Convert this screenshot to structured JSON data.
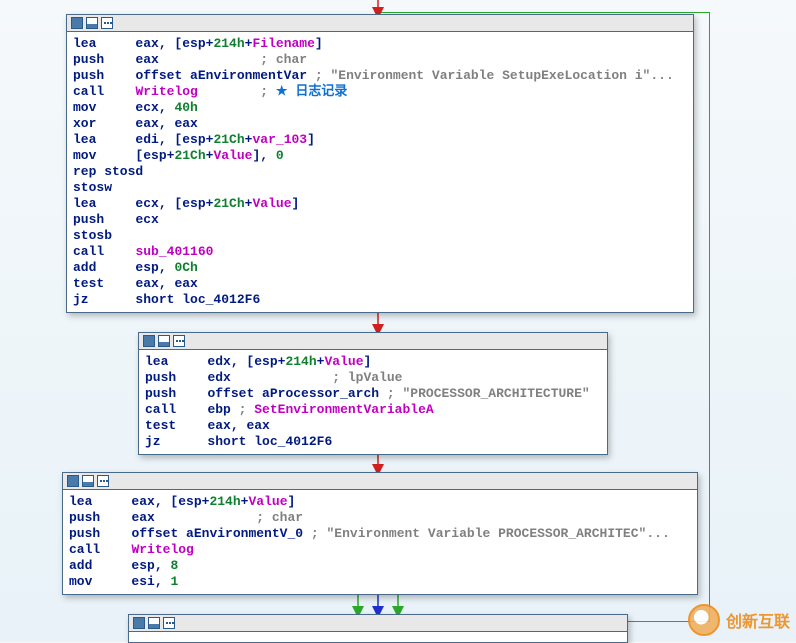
{
  "block1": {
    "lines": [
      [
        [
          "lea",
          "kw"
        ],
        [
          "     ",
          ""
        ],
        [
          "eax",
          ""
        ],
        [
          ", [",
          ""
        ],
        [
          "esp",
          "kw"
        ],
        [
          "+",
          ""
        ],
        [
          "214h",
          "num"
        ],
        [
          "+",
          ""
        ],
        [
          "Filename",
          "id"
        ],
        [
          "]",
          "pun"
        ]
      ],
      [
        [
          "push",
          "kw"
        ],
        [
          "    ",
          ""
        ],
        [
          "eax",
          ""
        ],
        [
          "             ; ",
          "str"
        ],
        [
          "char",
          "str"
        ]
      ],
      [
        [
          "push",
          "kw"
        ],
        [
          "    ",
          ""
        ],
        [
          "offset aEnvironmentVar",
          "kw"
        ],
        [
          " ; ",
          "str"
        ],
        [
          "\"Environment Variable SetupExeLocation i\"",
          "str"
        ],
        [
          "...",
          "str"
        ]
      ],
      [
        [
          "call",
          "kw"
        ],
        [
          "    ",
          ""
        ],
        [
          "Writelog",
          "id"
        ],
        [
          "        ; ",
          "str"
        ],
        [
          "★ 日志记录",
          "ann"
        ]
      ],
      [
        [
          "mov",
          "kw"
        ],
        [
          "     ",
          ""
        ],
        [
          "ecx",
          ""
        ],
        [
          ", ",
          ""
        ],
        [
          "40h",
          "num"
        ]
      ],
      [
        [
          "xor",
          "kw"
        ],
        [
          "     ",
          ""
        ],
        [
          "eax",
          ""
        ],
        [
          ", ",
          ""
        ],
        [
          "eax",
          ""
        ]
      ],
      [
        [
          "lea",
          "kw"
        ],
        [
          "     ",
          ""
        ],
        [
          "edi",
          ""
        ],
        [
          ", [",
          ""
        ],
        [
          "esp",
          "kw"
        ],
        [
          "+",
          ""
        ],
        [
          "21Ch",
          "num"
        ],
        [
          "+",
          ""
        ],
        [
          "var_103",
          "id"
        ],
        [
          "]",
          "pun"
        ]
      ],
      [
        [
          "mov",
          "kw"
        ],
        [
          "     [",
          ""
        ],
        [
          "esp",
          "kw"
        ],
        [
          "+",
          ""
        ],
        [
          "21Ch",
          "num"
        ],
        [
          "+",
          ""
        ],
        [
          "Value",
          "id"
        ],
        [
          "], ",
          ""
        ],
        [
          "0",
          "num"
        ]
      ],
      [
        [
          "rep stosd",
          "kw"
        ]
      ],
      [
        [
          "stosw",
          "kw"
        ]
      ],
      [
        [
          "lea",
          "kw"
        ],
        [
          "     ",
          ""
        ],
        [
          "ecx",
          ""
        ],
        [
          ", [",
          ""
        ],
        [
          "esp",
          "kw"
        ],
        [
          "+",
          ""
        ],
        [
          "21Ch",
          "num"
        ],
        [
          "+",
          ""
        ],
        [
          "Value",
          "id"
        ],
        [
          "]",
          "pun"
        ]
      ],
      [
        [
          "push",
          "kw"
        ],
        [
          "    ",
          ""
        ],
        [
          "ecx",
          ""
        ]
      ],
      [
        [
          "stosb",
          "kw"
        ]
      ],
      [
        [
          "call",
          "kw"
        ],
        [
          "    ",
          ""
        ],
        [
          "sub_401160",
          "id"
        ]
      ],
      [
        [
          "add",
          "kw"
        ],
        [
          "     ",
          ""
        ],
        [
          "esp",
          ""
        ],
        [
          ", ",
          ""
        ],
        [
          "0Ch",
          "num"
        ]
      ],
      [
        [
          "test",
          "kw"
        ],
        [
          "    ",
          ""
        ],
        [
          "eax",
          ""
        ],
        [
          ", ",
          ""
        ],
        [
          "eax",
          ""
        ]
      ],
      [
        [
          "jz",
          "kw"
        ],
        [
          "      ",
          ""
        ],
        [
          "short loc_4012F6",
          "kw"
        ]
      ]
    ]
  },
  "block2": {
    "lines": [
      [
        [
          "lea",
          "kw"
        ],
        [
          "     ",
          ""
        ],
        [
          "edx",
          ""
        ],
        [
          ", [",
          ""
        ],
        [
          "esp",
          "kw"
        ],
        [
          "+",
          ""
        ],
        [
          "214h",
          "num"
        ],
        [
          "+",
          ""
        ],
        [
          "Value",
          "id"
        ],
        [
          "]",
          "pun"
        ]
      ],
      [
        [
          "push",
          "kw"
        ],
        [
          "    ",
          ""
        ],
        [
          "edx",
          ""
        ],
        [
          "             ; ",
          "str"
        ],
        [
          "lpValue",
          "str"
        ]
      ],
      [
        [
          "push",
          "kw"
        ],
        [
          "    ",
          ""
        ],
        [
          "offset aProcessor_arch",
          "kw"
        ],
        [
          " ; ",
          "str"
        ],
        [
          "\"PROCESSOR_ARCHITECTURE\"",
          "str"
        ]
      ],
      [
        [
          "call",
          "kw"
        ],
        [
          "    ",
          ""
        ],
        [
          "ebp",
          ""
        ],
        [
          " ; ",
          "str"
        ],
        [
          "SetEnvironmentVariableA",
          "id"
        ]
      ],
      [
        [
          "test",
          "kw"
        ],
        [
          "    ",
          ""
        ],
        [
          "eax",
          ""
        ],
        [
          ", ",
          ""
        ],
        [
          "eax",
          ""
        ]
      ],
      [
        [
          "jz",
          "kw"
        ],
        [
          "      ",
          ""
        ],
        [
          "short loc_4012F6",
          "kw"
        ]
      ]
    ]
  },
  "block3": {
    "lines": [
      [
        [
          "lea",
          "kw"
        ],
        [
          "     ",
          ""
        ],
        [
          "eax",
          ""
        ],
        [
          ", [",
          ""
        ],
        [
          "esp",
          "kw"
        ],
        [
          "+",
          ""
        ],
        [
          "214h",
          "num"
        ],
        [
          "+",
          ""
        ],
        [
          "Value",
          "id"
        ],
        [
          "]",
          "pun"
        ]
      ],
      [
        [
          "push",
          "kw"
        ],
        [
          "    ",
          ""
        ],
        [
          "eax",
          ""
        ],
        [
          "             ; ",
          "str"
        ],
        [
          "char",
          "str"
        ]
      ],
      [
        [
          "push",
          "kw"
        ],
        [
          "    ",
          ""
        ],
        [
          "offset aEnvironmentV_0",
          "kw"
        ],
        [
          " ; ",
          "str"
        ],
        [
          "\"Environment Variable PROCESSOR_ARCHITEC\"",
          "str"
        ],
        [
          "...",
          "str"
        ]
      ],
      [
        [
          "call",
          "kw"
        ],
        [
          "    ",
          ""
        ],
        [
          "Writelog",
          "id"
        ]
      ],
      [
        [
          "add",
          "kw"
        ],
        [
          "     ",
          ""
        ],
        [
          "esp",
          ""
        ],
        [
          ", ",
          ""
        ],
        [
          "8",
          "num"
        ]
      ],
      [
        [
          "mov",
          "kw"
        ],
        [
          "     ",
          ""
        ],
        [
          "esi",
          ""
        ],
        [
          ", ",
          ""
        ],
        [
          "1",
          "num"
        ]
      ]
    ]
  },
  "watermark": "创新互联"
}
